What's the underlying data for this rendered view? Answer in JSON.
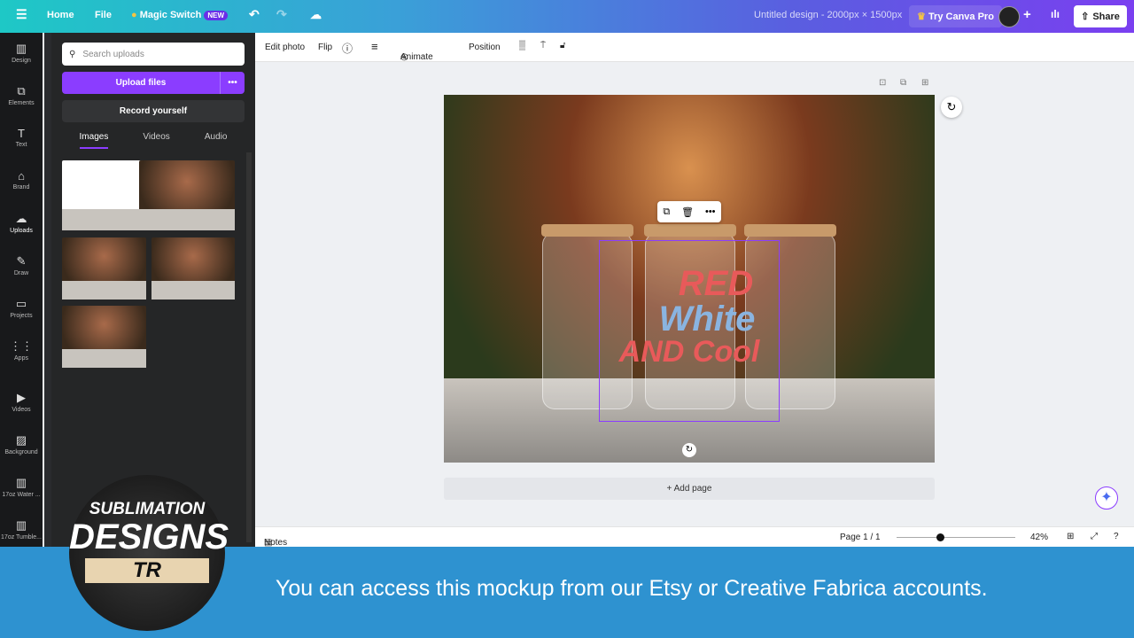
{
  "topbar": {
    "home": "Home",
    "file": "File",
    "magic_switch": "Magic Switch",
    "new_badge": "NEW",
    "title": "Untitled design - 2000px × 1500px",
    "try_pro": "Try Canva Pro",
    "share": "Share"
  },
  "rail": [
    {
      "label": "Design",
      "icon": "▥"
    },
    {
      "label": "Elements",
      "icon": "⧉"
    },
    {
      "label": "Text",
      "icon": "T"
    },
    {
      "label": "Brand",
      "icon": "⌂"
    },
    {
      "label": "Uploads",
      "icon": "☁"
    },
    {
      "label": "Draw",
      "icon": "✎"
    },
    {
      "label": "Projects",
      "icon": "▭"
    },
    {
      "label": "Apps",
      "icon": "⋮⋮"
    },
    {
      "label": "Videos",
      "icon": "▶"
    },
    {
      "label": "Background",
      "icon": "▨"
    },
    {
      "label": "17oz Water ...",
      "icon": "▥"
    },
    {
      "label": "17oz Tumble...",
      "icon": "▥"
    }
  ],
  "panel": {
    "search_placeholder": "Search uploads",
    "upload": "Upload files",
    "record": "Record yourself",
    "tabs": [
      "Images",
      "Videos",
      "Audio"
    ]
  },
  "toolbar": {
    "edit_photo": "Edit photo",
    "flip": "Flip",
    "animate": "Animate",
    "position": "Position"
  },
  "design_text": {
    "line1": "RED",
    "line2": "White",
    "line3": "AND Cool"
  },
  "add_page": "+ Add page",
  "footer": {
    "notes": "Notes",
    "page": "Page 1 / 1",
    "zoom": "42%",
    "zoom_level": 42
  },
  "banner": {
    "message": "You can access this mockup from our Etsy or Creative Fabrica accounts.",
    "logo_text": "SUBLIMATION DESIGNS TR"
  },
  "colors": {
    "accent": "#8b3dff",
    "banner": "#2e92d0"
  }
}
